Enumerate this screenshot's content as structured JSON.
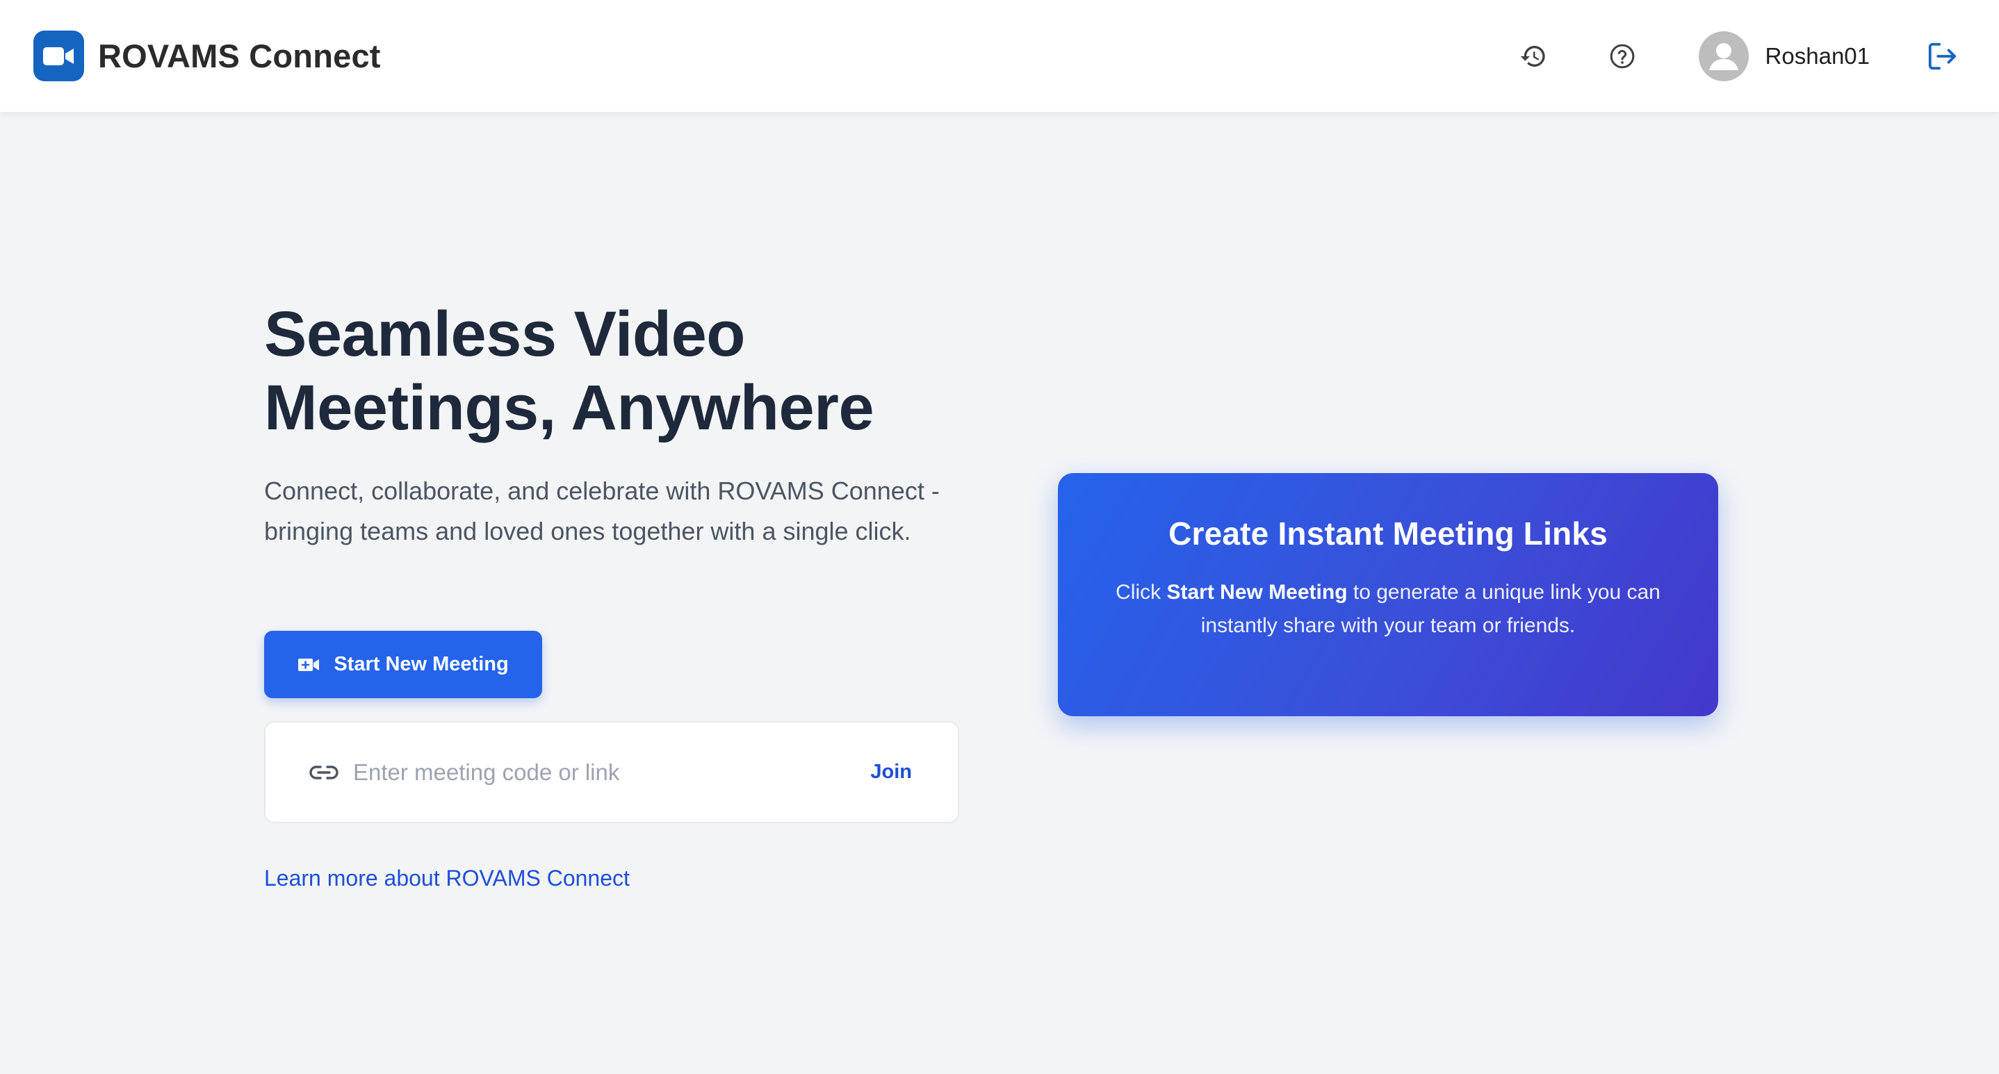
{
  "header": {
    "brand_title": "ROVAMS Connect",
    "username": "Roshan01",
    "icons": {
      "logo": "video-camera-icon",
      "history": "history-icon",
      "help": "help-circle-icon",
      "avatar": "account-circle-icon",
      "logout": "logout-icon"
    }
  },
  "hero": {
    "title_line1": "Seamless Video",
    "title_line2": "Meetings, Anywhere",
    "subtitle": "Connect, collaborate, and celebrate with ROVAMS Connect - bringing teams and loved ones together with a single click."
  },
  "actions": {
    "start_label": "Start New Meeting",
    "join_placeholder": "Enter meeting code or link",
    "join_value": "",
    "join_label": "Join",
    "learn_more": "Learn more about ROVAMS Connect"
  },
  "info_card": {
    "title": "Create Instant Meeting Links",
    "body_prefix": "Click ",
    "body_bold": "Start New Meeting",
    "body_suffix": " to generate a unique link you can instantly share with your team or friends."
  },
  "colors": {
    "primary": "#2563eb",
    "logo_bg": "#1565c0",
    "link": "#1d4ed8",
    "card_gradient_end": "#4338ca",
    "page_bg": "#f3f4f6"
  }
}
